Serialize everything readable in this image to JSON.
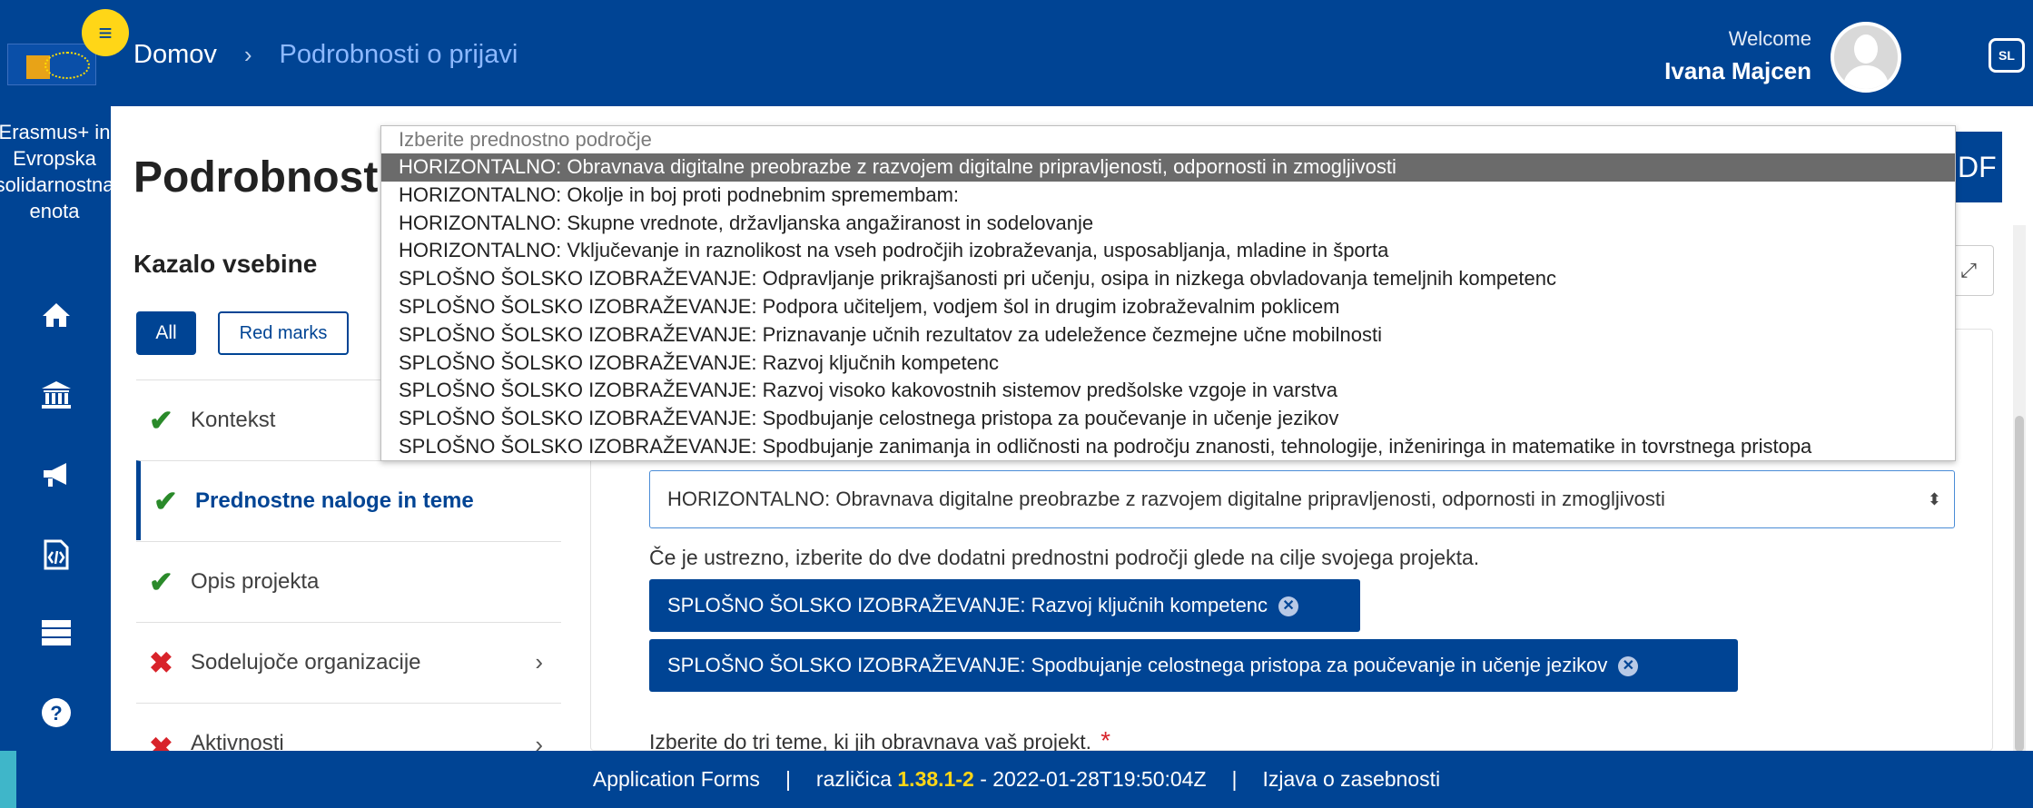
{
  "header": {
    "breadcrumb_home": "Domov",
    "breadcrumb_sep": "›",
    "breadcrumb_current": "Podrobnosti o prijavi",
    "welcome_label": "Welcome",
    "user_name": "Ivana Majcen",
    "lang_code": "SL",
    "menu_icon": "≡"
  },
  "rail": {
    "program_label": "Erasmus+ in Evropska solidarnostna enota",
    "icons": [
      "home-icon",
      "institution-icon",
      "megaphone-icon",
      "code-file-icon",
      "server-icon",
      "help-icon"
    ]
  },
  "page": {
    "title": "Podrobnosti",
    "pdf_label": "DF",
    "toc_title": "Kazalo vsebine",
    "filter_all": "All",
    "filter_red": "Red marks"
  },
  "toc": [
    {
      "label": "Kontekst",
      "status": "ok"
    },
    {
      "label": "Prednostne naloge in teme",
      "status": "ok"
    },
    {
      "label": "Opis projekta",
      "status": "ok"
    },
    {
      "label": "Sodelujoče organizacije",
      "status": "bad"
    },
    {
      "label": "Aktivnosti",
      "status": "bad"
    }
  ],
  "form": {
    "priority_value": "HORIZONTALNO: Obravnava digitalne preobrazbe z razvojem digitalne pripravljenosti, odpornosti in zmogljivosti",
    "additional_label": "Če je ustrezno, izberite do dve dodatni prednostni področji glede na cilje svojega projekta.",
    "chips": [
      "SPLOŠNO ŠOLSKO IZOBRAŽEVANJE: Razvoj ključnih kompetenc",
      "SPLOŠNO ŠOLSKO IZOBRAŽEVANJE: Spodbujanje celostnega pristopa za poučevanje in učenje jezikov"
    ],
    "topics_label": "Izberite do tri teme, ki jih obravnava vaš projekt.",
    "required_mark": "*"
  },
  "dropdown": {
    "placeholder": "Izberite prednostno področje",
    "options": [
      "HORIZONTALNO: Obravnava digitalne preobrazbe z razvojem digitalne pripravljenosti, odpornosti in zmogljivosti",
      "HORIZONTALNO: Okolje in boj proti podnebnim spremembam:",
      "HORIZONTALNO: Skupne vrednote, državljanska angažiranost in sodelovanje",
      "HORIZONTALNO: Vključevanje in raznolikost na vseh področjih izobraževanja, usposabljanja, mladine in športa",
      "SPLOŠNO ŠOLSKO IZOBRAŽEVANJE: Odpravljanje prikrajšanosti pri učenju, osipa in nizkega obvladovanja temeljnih kompetenc",
      "SPLOŠNO ŠOLSKO IZOBRAŽEVANJE: Podpora učiteljem, vodjem šol in drugim izobraževalnim poklicem",
      "SPLOŠNO ŠOLSKO IZOBRAŽEVANJE: Priznavanje učnih rezultatov za udeležence čezmejne učne mobilnosti",
      "SPLOŠNO ŠOLSKO IZOBRAŽEVANJE: Razvoj ključnih kompetenc",
      "SPLOŠNO ŠOLSKO IZOBRAŽEVANJE: Razvoj visoko kakovostnih sistemov predšolske vzgoje in varstva",
      "SPLOŠNO ŠOLSKO IZOBRAŽEVANJE: Spodbujanje celostnega pristopa za poučevanje in učenje jezikov",
      "SPLOŠNO ŠOLSKO IZOBRAŽEVANJE: Spodbujanje zanimanja in odličnosti na področju znanosti, tehnologije, inženiringa in matematike in tovrstnega pristopa"
    ],
    "selected_index": 0
  },
  "footer": {
    "app": "Application Forms",
    "sep": "|",
    "version_label": "različica",
    "version": "1.38.1-2",
    "build": "- 2022-01-28T19:50:04Z",
    "privacy": "Izjava o zasebnosti"
  },
  "colors": {
    "brand": "#004494",
    "accent_yellow": "#ffd617",
    "ok": "#2a8a2a",
    "error": "#d8232a"
  }
}
